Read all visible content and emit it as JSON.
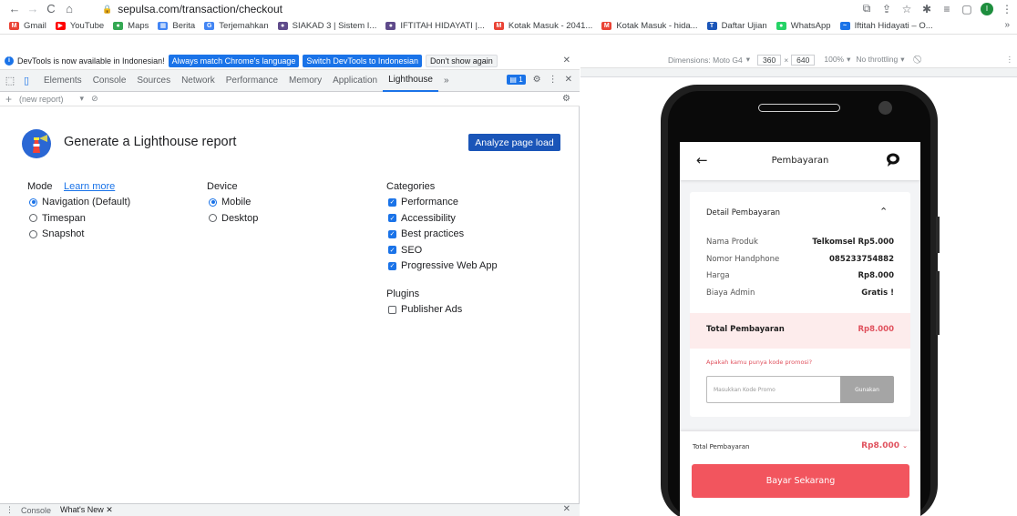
{
  "browser": {
    "url": "sepulsa.com/transaction/checkout",
    "profile_initial": "I",
    "bookmarks": [
      {
        "label": "Gmail",
        "color": "#ea4335",
        "glyph": "M"
      },
      {
        "label": "YouTube",
        "color": "#ff0000",
        "glyph": "▶"
      },
      {
        "label": "Maps",
        "color": "#34a853",
        "glyph": "●"
      },
      {
        "label": "Berita",
        "color": "#4285f4",
        "glyph": "▦"
      },
      {
        "label": "Terjemahkan",
        "color": "#4285f4",
        "glyph": "G"
      },
      {
        "label": "SIAKAD 3 | Sistem I...",
        "color": "#5f4b8b",
        "glyph": "●"
      },
      {
        "label": "IFTITAH HIDAYATI |...",
        "color": "#5f4b8b",
        "glyph": "●"
      },
      {
        "label": "Kotak Masuk - 2041...",
        "color": "#ea4335",
        "glyph": "M"
      },
      {
        "label": "Kotak Masuk - hida...",
        "color": "#ea4335",
        "glyph": "M"
      },
      {
        "label": "Daftar Ujian",
        "color": "#1a55b8",
        "glyph": "T"
      },
      {
        "label": "WhatsApp",
        "color": "#25d366",
        "glyph": "●"
      },
      {
        "label": "Iftitah Hidayati – O...",
        "color": "#1a73e8",
        "glyph": "~"
      }
    ],
    "more": "»"
  },
  "devtools": {
    "infobar": {
      "message": "DevTools is now available in Indonesian!",
      "btn_match": "Always match Chrome's language",
      "btn_switch": "Switch DevTools to Indonesian",
      "btn_dismiss": "Don't show again"
    },
    "tabs": [
      "Elements",
      "Console",
      "Sources",
      "Network",
      "Performance",
      "Memory",
      "Application",
      "Lighthouse"
    ],
    "active_tab": "Lighthouse",
    "tabs_more": "»",
    "issues_count": "1",
    "report_select": "(new report)",
    "lighthouse": {
      "title": "Generate a Lighthouse report",
      "analyze_label": "Analyze page load",
      "mode_title": "Mode",
      "learn_more": "Learn more",
      "modes": [
        {
          "label": "Navigation (Default)",
          "selected": true
        },
        {
          "label": "Timespan",
          "selected": false
        },
        {
          "label": "Snapshot",
          "selected": false
        }
      ],
      "device_title": "Device",
      "devices": [
        {
          "label": "Mobile",
          "selected": true
        },
        {
          "label": "Desktop",
          "selected": false
        }
      ],
      "categories_title": "Categories",
      "categories": [
        {
          "label": "Performance",
          "checked": true
        },
        {
          "label": "Accessibility",
          "checked": true
        },
        {
          "label": "Best practices",
          "checked": true
        },
        {
          "label": "SEO",
          "checked": true
        },
        {
          "label": "Progressive Web App",
          "checked": true
        }
      ],
      "plugins_title": "Plugins",
      "plugins": [
        {
          "label": "Publisher Ads",
          "checked": false
        }
      ]
    },
    "drawer": {
      "console": "Console",
      "whats_new": "What's New"
    }
  },
  "device_toolbar": {
    "dimensions": "Dimensions: Moto G4",
    "width": "360",
    "height": "640",
    "zoom": "100%",
    "throttling": "No throttling"
  },
  "app": {
    "title": "Pembayaran",
    "detail_title": "Detail Pembayaran",
    "rows": [
      {
        "label": "Nama Produk",
        "value": "Telkomsel Rp5.000"
      },
      {
        "label": "Nomor Handphone",
        "value": "085233754882"
      },
      {
        "label": "Harga",
        "value": "Rp8.000"
      },
      {
        "label": "Biaya Admin",
        "value": "Gratis !"
      }
    ],
    "total_label": "Total Pembayaran",
    "total_value": "Rp8.000",
    "promo_question": "Apakah kamu punya kode promosi?",
    "promo_placeholder": "Masukkan Kode Promo",
    "promo_button": "Gunakan",
    "bottom_total_label": "Total Pembayaran",
    "bottom_total_value": "Rp8.000",
    "pay_button": "Bayar Sekarang"
  }
}
